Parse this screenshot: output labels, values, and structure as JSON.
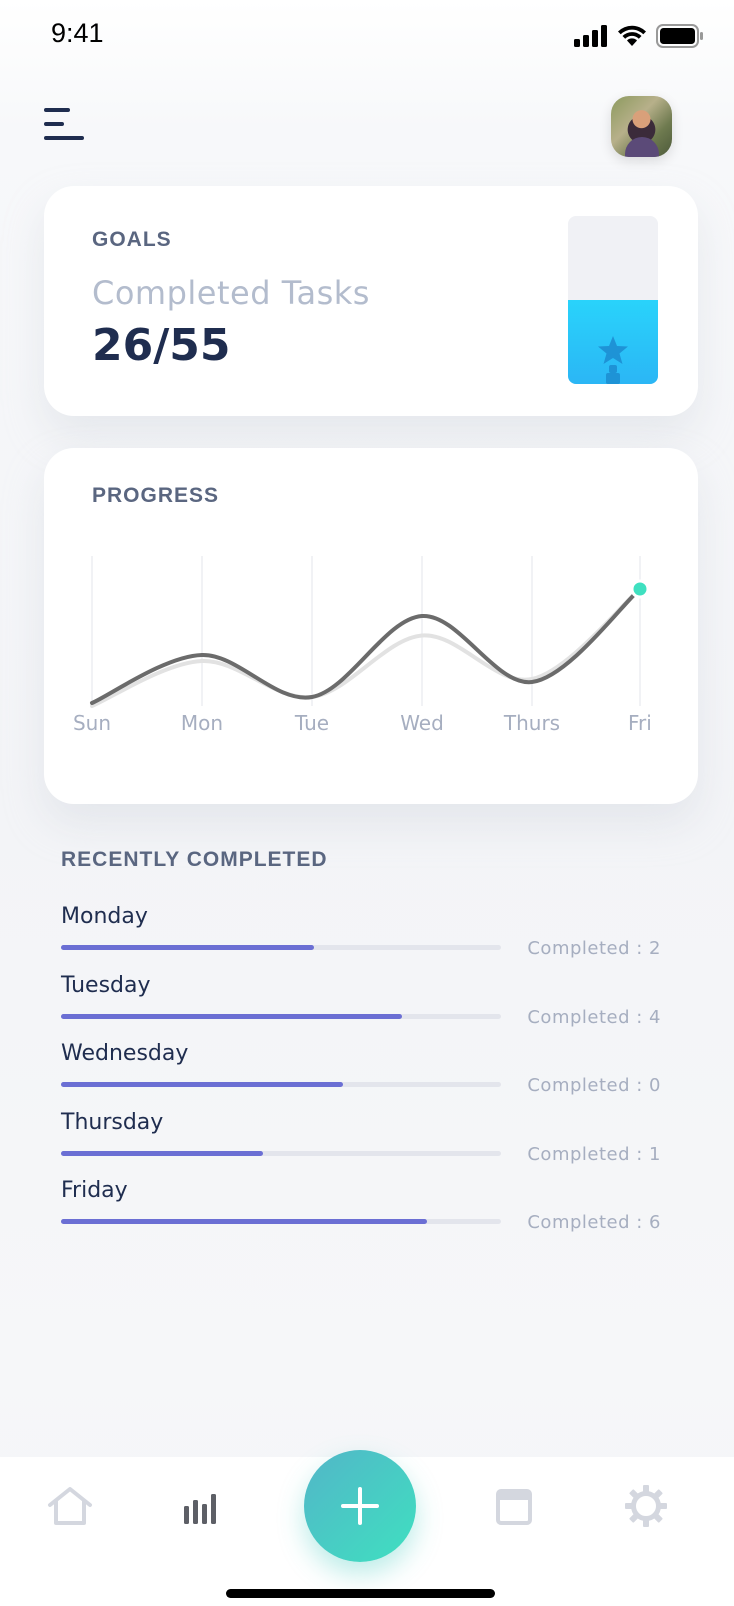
{
  "status_bar": {
    "time": "9:41"
  },
  "goals": {
    "label": "GOALS",
    "subtitle": "Completed Tasks",
    "value": "26/55",
    "meter_fill_fraction": 0.5
  },
  "progress": {
    "label": "PROGRESS"
  },
  "chart_data": {
    "type": "line",
    "title": "",
    "xlabel": "",
    "ylabel": "",
    "categories": [
      "Sun",
      "Mon",
      "Tue",
      "Wed",
      "Thurs",
      "Fri"
    ],
    "grid": "vertical",
    "series": [
      {
        "values": [
          1.0,
          4.2,
          1.4,
          6.8,
          2.4,
          8.6
        ],
        "color": "#6b6b6b"
      },
      {
        "values": [
          0.8,
          3.8,
          1.4,
          5.5,
          2.6,
          8.6
        ],
        "color": "#e2e2e2"
      }
    ],
    "highlight_point": {
      "category": "Fri",
      "color": "#3fe0c0"
    },
    "ylim": [
      0,
      10
    ]
  },
  "recent": {
    "label": "RECENTLY COMPLETED",
    "items": [
      {
        "day": "Monday",
        "count_text": "Completed : 2",
        "fraction": 0.575
      },
      {
        "day": "Tuesday",
        "count_text": "Completed : 4",
        "fraction": 0.775
      },
      {
        "day": "Wednesday",
        "count_text": "Completed : 0",
        "fraction": 0.64
      },
      {
        "day": "Thursday",
        "count_text": "Completed : 1",
        "fraction": 0.46
      },
      {
        "day": "Friday",
        "count_text": "Completed : 6",
        "fraction": 0.832
      }
    ]
  },
  "nav": {
    "items": [
      "home-icon",
      "stats-icon",
      "add-icon",
      "calendar-icon",
      "settings-icon"
    ],
    "active": "stats-icon"
  },
  "colors": {
    "primary_text": "#1f2d4f",
    "accent_purple": "#6b6fd4",
    "accent_cyan": "#29d3fb",
    "accent_teal": "#3fe0c0"
  }
}
